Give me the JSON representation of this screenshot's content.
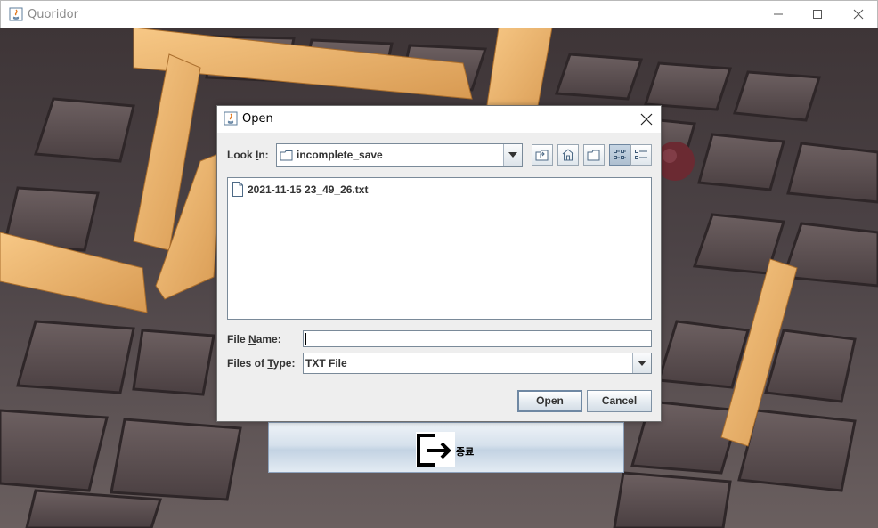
{
  "window": {
    "title": "Quoridor"
  },
  "exit_button": {
    "label": "종료",
    "icon": "exit-door-icon"
  },
  "dialog": {
    "title": "Open",
    "look_in": {
      "label_pre": "Look ",
      "label_mnemonic": "I",
      "label_post": "n:",
      "value": "incomplete_save"
    },
    "toolbar": {
      "buttons": [
        "up-one-level-icon",
        "home-icon",
        "new-folder-icon",
        "list-view-icon",
        "details-view-icon"
      ],
      "active": "list-view-icon"
    },
    "files": [
      {
        "name": "2021-11-15 23_49_26.txt",
        "icon": "file-icon"
      }
    ],
    "file_name": {
      "label_pre": "File ",
      "label_mnemonic": "N",
      "label_post": "ame:",
      "value": ""
    },
    "file_type": {
      "label_pre": "Files of ",
      "label_mnemonic": "T",
      "label_post": "ype:",
      "value": "TXT File"
    },
    "open_label": "Open",
    "cancel_label": "Cancel"
  }
}
